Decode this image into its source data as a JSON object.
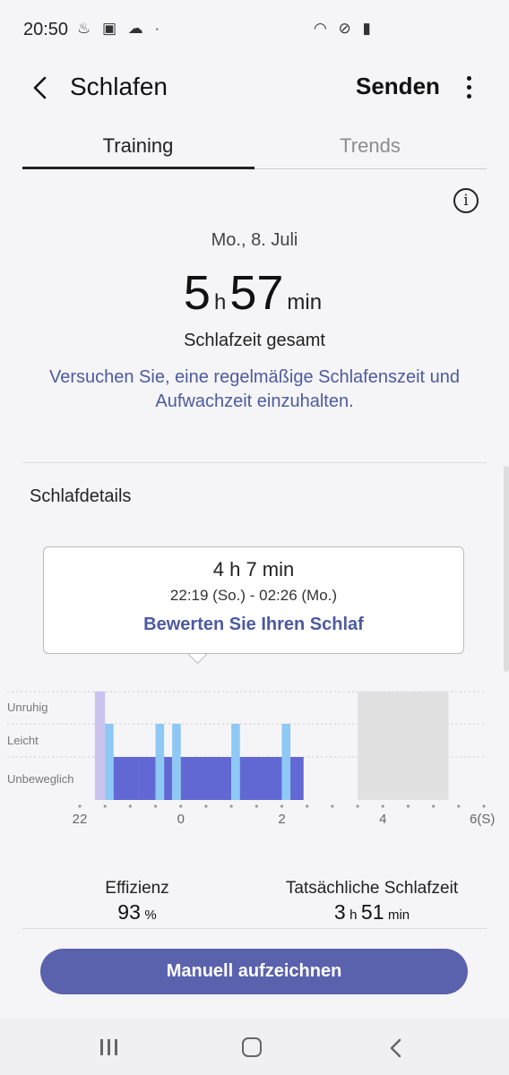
{
  "status_bar": {
    "time": "20:50",
    "left_icons": "♨ ▣ ☁ ·",
    "right_icons": "◠ ⊘ ▮"
  },
  "header": {
    "title": "Schlafen",
    "send_label": "Senden"
  },
  "tabs": [
    {
      "label": "Training",
      "active": true
    },
    {
      "label": "Trends",
      "active": false
    }
  ],
  "summary": {
    "date": "Mo., 8. Juli",
    "hours": "5",
    "hours_unit": "h",
    "minutes": "57",
    "minutes_unit": "min",
    "label": "Schlafzeit gesamt",
    "tip_line1": "Versuchen Sie, eine regelmäßige Schlafenszeit und",
    "tip_line2": "Aufwachzeit einzuhalten."
  },
  "details": {
    "title": "Schlafdetails",
    "tooltip": {
      "duration": "4 h 7 min",
      "range": "22:19 (So.) - 02:26 (Mo.)",
      "rate_link": "Bewerten Sie Ihren Schlaf"
    }
  },
  "chart_data": {
    "type": "bar",
    "rows": [
      "Unruhig",
      "Leicht",
      "Unbeweglich"
    ],
    "x_ticks": [
      "22",
      "0",
      "2",
      "4",
      "6(S)"
    ],
    "x_range": [
      22,
      30
    ],
    "segments": [
      {
        "start": 22.3,
        "end": 22.5,
        "level": "Unruhig",
        "color": "#c9c3ee"
      },
      {
        "start": 22.5,
        "end": 22.67,
        "level": "Leicht",
        "color": "#8ec8f5"
      },
      {
        "start": 22.67,
        "end": 23.17,
        "level": "Unbeweglich",
        "color": "#6168d3"
      },
      {
        "start": 23.17,
        "end": 23.5,
        "level": "Unbeweglich",
        "color": "#6168d3"
      },
      {
        "start": 23.5,
        "end": 23.67,
        "level": "Leicht",
        "color": "#8ec8f5"
      },
      {
        "start": 23.67,
        "end": 23.83,
        "level": "Unbeweglich",
        "color": "#6168d3"
      },
      {
        "start": 23.83,
        "end": 24.0,
        "level": "Leicht",
        "color": "#8ec8f5"
      },
      {
        "start": 24.0,
        "end": 25.0,
        "level": "Unbeweglich",
        "color": "#6168d3"
      },
      {
        "start": 25.0,
        "end": 25.17,
        "level": "Leicht",
        "color": "#8ec8f5"
      },
      {
        "start": 25.17,
        "end": 26.0,
        "level": "Unbeweglich",
        "color": "#6168d3"
      },
      {
        "start": 26.0,
        "end": 26.17,
        "level": "Leicht",
        "color": "#8ec8f5"
      },
      {
        "start": 26.17,
        "end": 26.43,
        "level": "Unbeweglich",
        "color": "#6168d3"
      },
      {
        "start": 27.5,
        "end": 29.3,
        "level": "Unruhig",
        "color": "#e1e1e1"
      }
    ]
  },
  "stats": {
    "efficiency_label": "Effizienz",
    "efficiency_value": "93",
    "efficiency_unit": "%",
    "actual_label": "Tatsächliche Schlafzeit",
    "actual_hours": "3",
    "actual_hours_unit": "h",
    "actual_minutes": "51",
    "actual_minutes_unit": "min"
  },
  "action": {
    "record_label": "Manuell aufzeichnen"
  }
}
